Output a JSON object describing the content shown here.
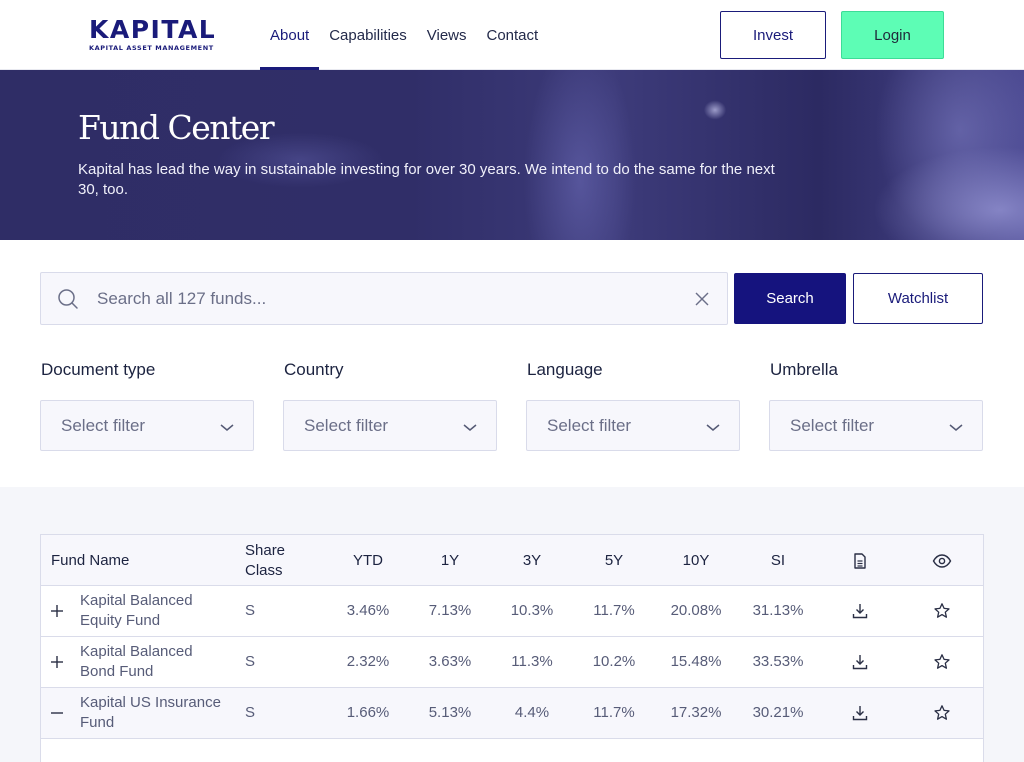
{
  "header": {
    "logo": {
      "name": "KAPITAL",
      "tagline": "KAPITAL ASSET MANAGEMENT"
    },
    "nav": [
      {
        "label": "About",
        "active": true
      },
      {
        "label": "Capabilities",
        "active": false
      },
      {
        "label": "Views",
        "active": false
      },
      {
        "label": "Contact",
        "active": false
      }
    ],
    "invest_label": "Invest",
    "login_label": "Login"
  },
  "hero": {
    "title": "Fund Center",
    "description": "Kapital has lead the way in sustainable investing for over 30 years. We intend to do the same for the next 30, too."
  },
  "search": {
    "placeholder": "Search all 127 funds...",
    "value": "",
    "search_label": "Search",
    "watchlist_label": "Watchlist"
  },
  "filters": [
    {
      "label": "Document type",
      "value": "Select filter"
    },
    {
      "label": "Country",
      "value": "Select filter"
    },
    {
      "label": "Language",
      "value": "Select filter"
    },
    {
      "label": "Umbrella",
      "value": "Select filter"
    }
  ],
  "table": {
    "columns": [
      "Fund Name",
      "Share Class",
      "YTD",
      "1Y",
      "3Y",
      "5Y",
      "10Y",
      "SI",
      "document-icon",
      "eye-icon"
    ],
    "rows": [
      {
        "expanded": false,
        "fund_name": "Kapital Balanced Equity Fund",
        "share_class": "S",
        "ytd": "3.46%",
        "y1": "7.13%",
        "y3": "10.3%",
        "y5": "11.7%",
        "y10": "20.08%",
        "si": "31.13%"
      },
      {
        "expanded": false,
        "fund_name": "Kapital Balanced Bond Fund",
        "share_class": "S",
        "ytd": "2.32%",
        "y1": "3.63%",
        "y3": "11.3%",
        "y5": "10.2%",
        "y10": "15.48%",
        "si": "33.53%"
      },
      {
        "expanded": true,
        "fund_name": "Kapital US Insurance Fund",
        "share_class": "S",
        "ytd": "1.66%",
        "y1": "5.13%",
        "y3": "4.4%",
        "y5": "11.7%",
        "y10": "17.32%",
        "si": "30.21%"
      }
    ]
  },
  "colors": {
    "brand_navy": "#1a1b7a",
    "search_button": "#15137e",
    "login_green": "#5dfdb5",
    "hero_bg": "#2f2d66"
  }
}
